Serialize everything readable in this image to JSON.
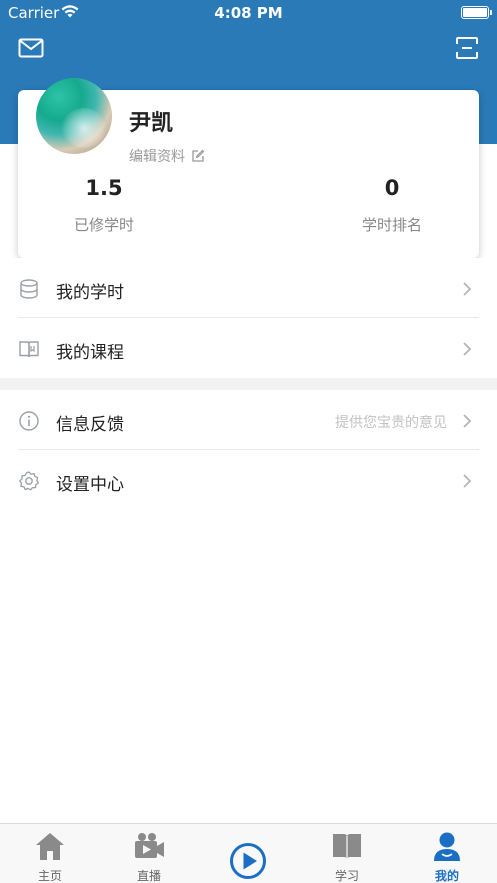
{
  "status_bar": {
    "carrier": "Carrier",
    "time": "4:08 PM"
  },
  "colors": {
    "header_blue": "#2a7ab8",
    "tab_active": "#1a6fc4"
  },
  "profile": {
    "name": "尹凯",
    "edit_label": "编辑资料",
    "stats": [
      {
        "value": "1.5",
        "label": "已修学时"
      },
      {
        "value": "0",
        "label": "学时排名"
      }
    ]
  },
  "menu": {
    "group1": [
      {
        "label": "我的学时",
        "icon": "database-icon"
      },
      {
        "label": "我的课程",
        "icon": "book-icon"
      }
    ],
    "group2": [
      {
        "label": "信息反馈",
        "icon": "info-icon",
        "hint": "提供您宝贵的意见"
      },
      {
        "label": "设置中心",
        "icon": "gear-icon"
      }
    ]
  },
  "tabs": [
    {
      "label": "主页",
      "icon": "home-icon"
    },
    {
      "label": "直播",
      "icon": "video-camera-icon"
    },
    {
      "label": "",
      "icon": "play-circle-icon"
    },
    {
      "label": "学习",
      "icon": "open-book-icon"
    },
    {
      "label": "我的",
      "icon": "person-icon",
      "active": true
    }
  ]
}
